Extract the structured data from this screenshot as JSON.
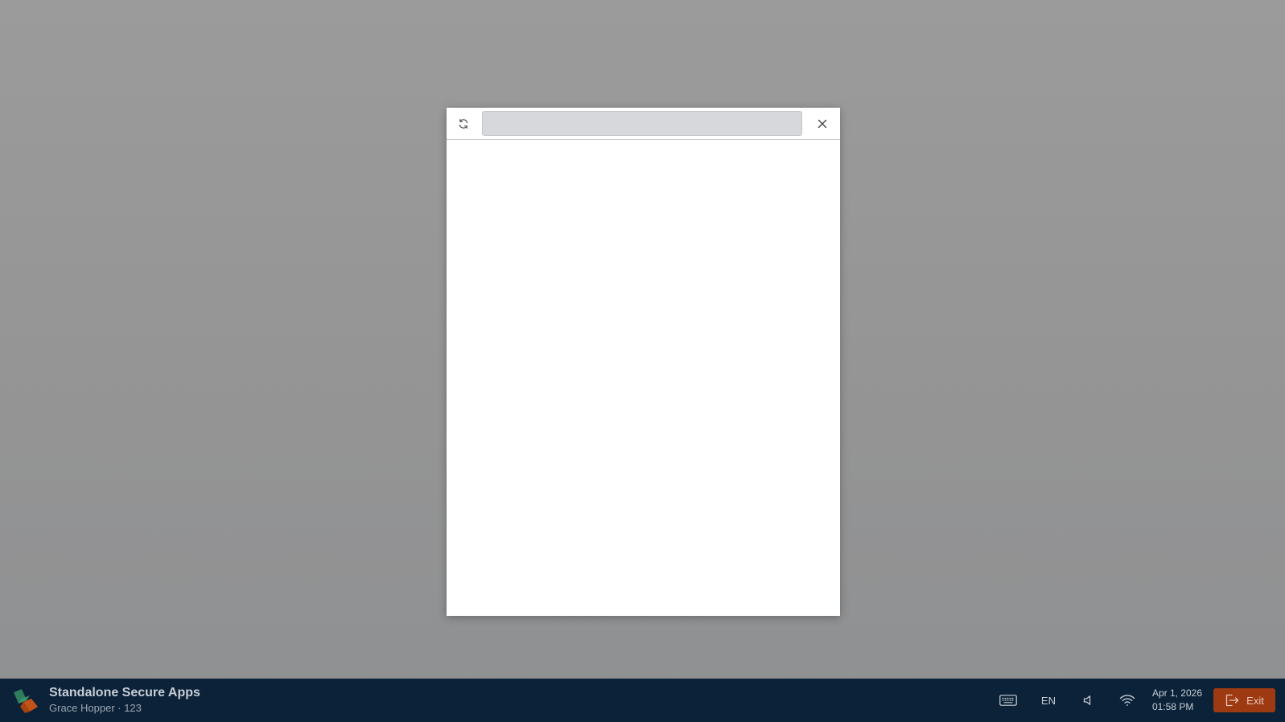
{
  "dialog": {
    "address_value": "",
    "address_placeholder": "",
    "icons": {
      "refresh": "refresh-icon",
      "close": "close-icon"
    }
  },
  "taskbar": {
    "app_title": "Standalone Secure Apps",
    "user_line": "Grace Hopper · 123",
    "language": "EN",
    "date": "Apr 1, 2026",
    "time": "01:58 PM",
    "exit_label": "Exit",
    "icons": {
      "logo": "app-logo",
      "keyboard": "keyboard-icon",
      "volume": "volume-icon",
      "wifi": "wifi-icon",
      "exit": "exit-icon"
    }
  },
  "colors": {
    "background": "#969696",
    "taskbar": "#0b2238",
    "exit_button": "#9d3a12",
    "logo_green": "#2e7d5b",
    "logo_orange": "#c2521a"
  }
}
